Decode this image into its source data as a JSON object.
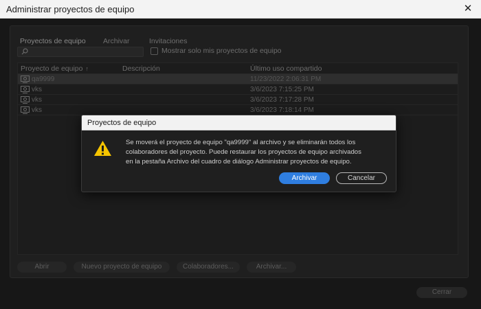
{
  "window": {
    "title": "Administrar proyectos de equipo",
    "close_glyph": "✕"
  },
  "tabs": [
    {
      "label": "Proyectos de equipo",
      "active": true
    },
    {
      "label": "Archivar",
      "active": false
    },
    {
      "label": "Invitaciones",
      "active": false
    }
  ],
  "search": {
    "value": "",
    "placeholder": ""
  },
  "filter": {
    "label": "Mostrar solo mis proyectos de equipo",
    "checked": false
  },
  "table": {
    "columns": [
      "Proyecto de equipo",
      "Descripción",
      "Último uso compartido"
    ],
    "sort_indicator": "↑",
    "rows": [
      {
        "name": "qa9999",
        "description": "",
        "last_used": "11/23/2022 2:06:31 PM",
        "selected": true
      },
      {
        "name": "vks",
        "description": "",
        "last_used": "3/6/2023 7:15:25 PM",
        "selected": false
      },
      {
        "name": "vks",
        "description": "",
        "last_used": "3/6/2023 7:17:28 PM",
        "selected": false
      },
      {
        "name": "vks",
        "description": "",
        "last_used": "3/6/2023 7:18:14 PM",
        "selected": false
      }
    ]
  },
  "buttons": {
    "open": "Abrir",
    "new_project": "Nuevo proyecto de equipo",
    "collaborators": "Colaboradores...",
    "archive": "Archivar...",
    "close": "Cerrar"
  },
  "modal": {
    "title": "Proyectos de equipo",
    "icon": "warning-icon",
    "message_lines": [
      "Se moverá el proyecto de equipo \"qa9999\" al archivo y se eliminarán todos los",
      "colaboradores del proyecto. Puede restaurar los proyectos de equipo archivados",
      "en la pestaña Archivo del cuadro de diálogo Administrar proyectos de equipo."
    ],
    "confirm_label": "Archivar",
    "cancel_label": "Cancelar"
  },
  "colors": {
    "accent": "#2f7ee0",
    "warning": "#f5c400",
    "background": "#171717"
  }
}
